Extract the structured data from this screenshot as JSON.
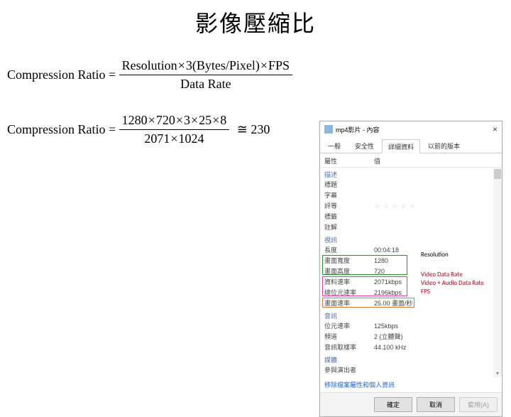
{
  "title": "影像壓縮比",
  "formula1": {
    "lhs": "Compression Ratio = ",
    "numParts": [
      "Resolution",
      "×",
      "3(Bytes/Pixel)",
      "×",
      "FPS"
    ],
    "den": "Data Rate"
  },
  "formula2": {
    "lhs": "Compression Ratio = ",
    "numParts": [
      "1280",
      "×",
      "720",
      "×",
      "3",
      "×",
      "25",
      "×",
      "8"
    ],
    "denParts": [
      "2071",
      "×",
      "1024"
    ],
    "approx": "≅ 230"
  },
  "dialog": {
    "title": "mp4影片 - 內容",
    "close": "×",
    "tabs": [
      "一般",
      "安全性",
      "詳細資料",
      "以前的版本"
    ],
    "activeTab": 2,
    "headProp": "屬性",
    "headVal": "值",
    "sectionDesc": "描述",
    "rows_desc": [
      {
        "k": "標題",
        "v": ""
      },
      {
        "k": "字幕",
        "v": ""
      },
      {
        "k": "評等",
        "v": "☆ ☆ ☆ ☆ ☆"
      },
      {
        "k": "標籤",
        "v": ""
      },
      {
        "k": "註解",
        "v": ""
      }
    ],
    "sectionVideo": "視訊",
    "rows_video": [
      {
        "k": "長度",
        "v": "00:04:18"
      },
      {
        "k": "畫面寬度",
        "v": "1280"
      },
      {
        "k": "畫面高度",
        "v": "720"
      },
      {
        "k": "資料速率",
        "v": "2071kbps"
      },
      {
        "k": "總位元速率",
        "v": "2196kbps"
      },
      {
        "k": "畫面速率",
        "v": "25.00 畫面/秒"
      }
    ],
    "sectionAudio": "音訊",
    "rows_audio": [
      {
        "k": "位元速率",
        "v": "125kbps"
      },
      {
        "k": "頻道",
        "v": "2 (立體聲)"
      },
      {
        "k": "音訊取樣率",
        "v": "44.100 kHz"
      }
    ],
    "sectionMedia": "媒體",
    "rows_media": [
      {
        "k": "參與演出者",
        "v": ""
      }
    ],
    "link": "移除檔案屬性和個人資訊",
    "btnOk": "確定",
    "btnCancel": "取消",
    "btnApply": "套用(A)"
  },
  "annot": {
    "resolution": "Resolution",
    "videoDataRate": "Video Data Rate",
    "videoAudioDataRate": "Video + Audio Data Rate",
    "fps": "FPS"
  }
}
